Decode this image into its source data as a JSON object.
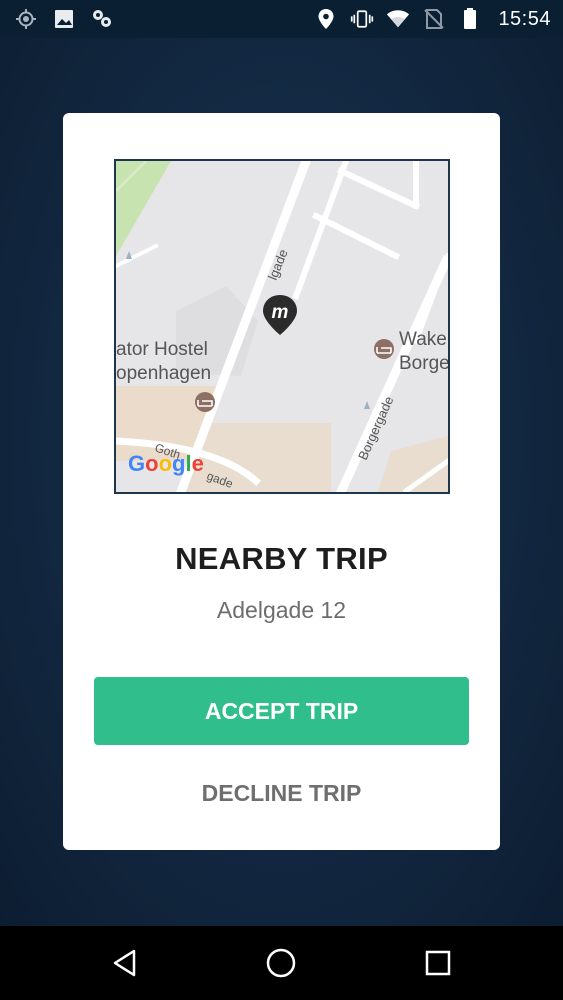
{
  "status_bar": {
    "time": "15:54",
    "left_icons": [
      "location-target-icon",
      "image-icon",
      "app-icon"
    ],
    "right_icons": [
      "location-pin-icon",
      "vibrate-icon",
      "wifi-icon",
      "no-sim-icon",
      "battery-icon"
    ]
  },
  "map": {
    "streets": [
      "Adelgade",
      "Borgergade",
      "Gothersgade"
    ],
    "places": [
      "Generator Hostel Copenhagen",
      "Wakeup Borgergade"
    ],
    "place_labels": {
      "hostel_line1": "ator Hostel",
      "hostel_line2": "openhagen",
      "wake_line1": "Wake",
      "wake_line2": "Borge",
      "adelgade": "lgade",
      "borgergade": "Borgergade",
      "gothersgade_1": "Goth",
      "gothersgade_2": "gade"
    },
    "attribution": "Google",
    "marker_letter": "m"
  },
  "dialog": {
    "title": "NEARBY TRIP",
    "address": "Adelgade 12",
    "accept_label": "ACCEPT TRIP",
    "decline_label": "DECLINE TRIP"
  },
  "colors": {
    "accent": "#2fbe8c",
    "background": "#0f2238"
  },
  "nav_bar": {
    "buttons": [
      "back-icon",
      "home-icon",
      "recents-icon"
    ]
  }
}
